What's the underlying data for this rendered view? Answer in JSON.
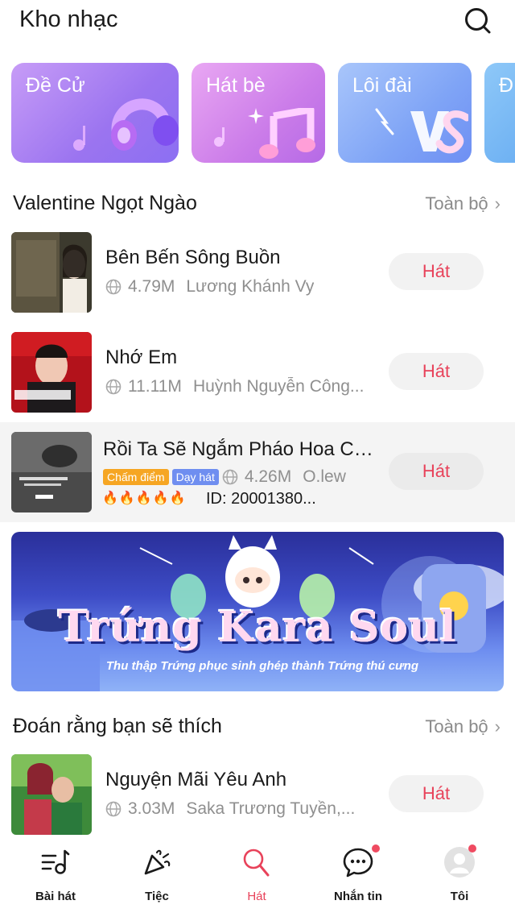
{
  "header": {
    "title": "Kho nhạc",
    "search_icon": "search-icon"
  },
  "categories": [
    {
      "label": "Đề Cử",
      "icon": "headphones-icon"
    },
    {
      "label": "Hát bè",
      "icon": "music-note-icon"
    },
    {
      "label": "Lôi đài",
      "icon": "vs-icon"
    },
    {
      "label": "Đ",
      "icon": ""
    }
  ],
  "section1": {
    "title": "Valentine Ngọt Ngào",
    "more": "Toàn bộ",
    "songs": [
      {
        "title": "Bên Bến Sông Buồn",
        "count": "4.79M",
        "artist": "Lương Khánh Vy",
        "button": "Hát"
      },
      {
        "title": "Nhớ Em",
        "count": "11.11M",
        "artist": "Huỳnh Nguyễn Công...",
        "button": "Hát"
      },
      {
        "title": "Rồi Ta Sẽ Ngắm Pháo Hoa Cù...",
        "badge1": "Chấm điểm",
        "badge2": "Dạy hát",
        "count": "4.26M",
        "artist": "O.lew",
        "flames": "🔥🔥🔥🔥🔥",
        "song_id": "ID: 20001380...",
        "button": "Hát"
      }
    ]
  },
  "banner": {
    "title": "Trứng Kara Soul",
    "subtitle": "Thu thập Trứng phục sinh ghép thành Trứng thú cưng"
  },
  "section2": {
    "title": "Đoán rằng bạn sẽ thích",
    "more": "Toàn bộ",
    "songs": [
      {
        "title": "Nguyện Mãi Yêu Anh",
        "count": "3.03M",
        "artist": "Saka Trương Tuyền,...",
        "button": "Hát"
      }
    ]
  },
  "bottom_nav": [
    {
      "label": "Bài hát",
      "icon": "song-list-icon",
      "active": false
    },
    {
      "label": "Tiệc",
      "icon": "party-icon",
      "active": false
    },
    {
      "label": "Hát",
      "icon": "microphone-icon",
      "active": true
    },
    {
      "label": "Nhắn tin",
      "icon": "chat-icon",
      "active": false
    },
    {
      "label": "Tôi",
      "icon": "avatar-icon",
      "active": false
    }
  ],
  "colors": {
    "accent": "#e8425a",
    "gray_text": "#8f8f8f",
    "badge_orange": "#f6a623",
    "badge_blue": "#6f8ef0"
  }
}
